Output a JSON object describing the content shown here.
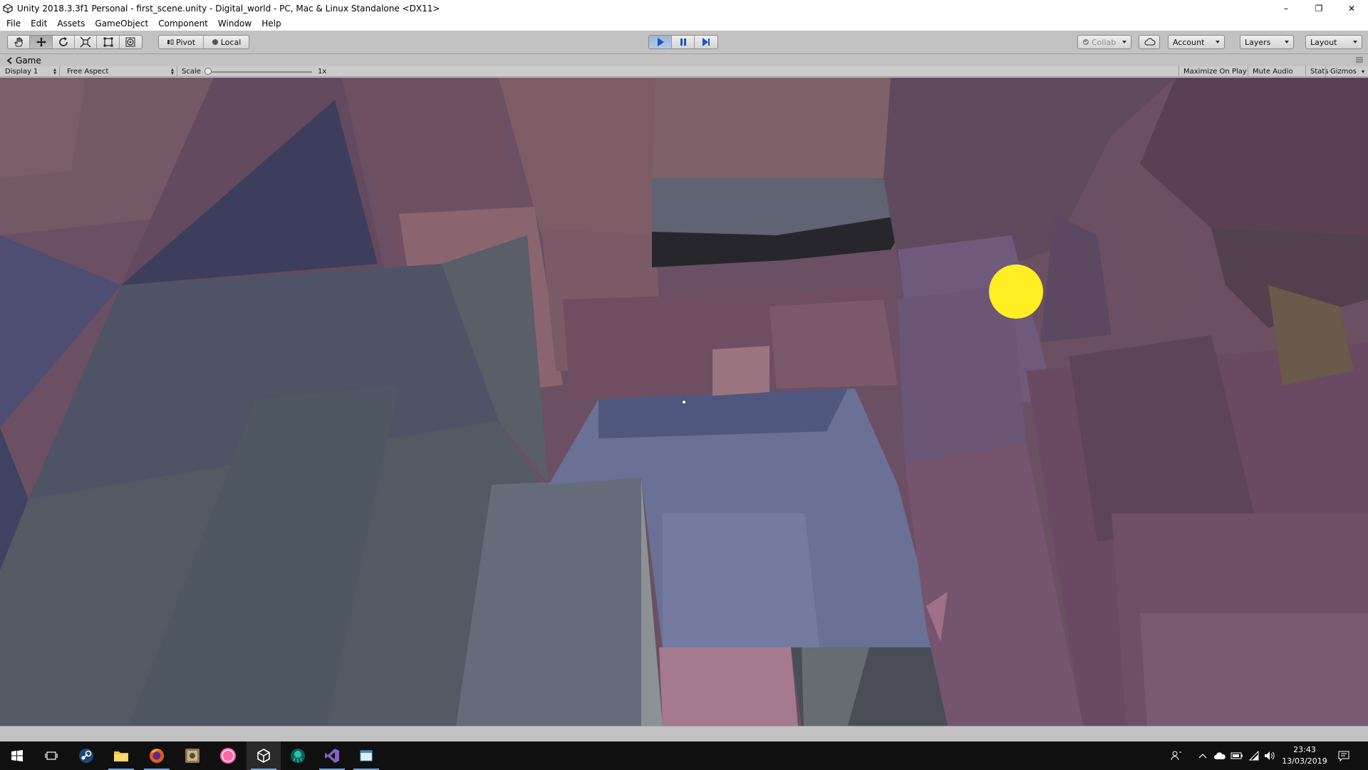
{
  "window": {
    "title": "Unity 2018.3.3f1 Personal - first_scene.unity - Digital_world - PC, Mac & Linux Standalone <DX11>",
    "controls": {
      "minimize": "–",
      "restore": "❐",
      "close": "✕"
    }
  },
  "menu": [
    "File",
    "Edit",
    "Assets",
    "GameObject",
    "Component",
    "Window",
    "Help"
  ],
  "toolbar": {
    "tools": [
      "hand-tool",
      "move-tool",
      "rotate-tool",
      "scale-tool",
      "rect-tool",
      "transform-tool"
    ],
    "active_tool": "move-tool",
    "pivot_label": "Pivot",
    "local_label": "Local",
    "play": {
      "playing": true,
      "paused": false
    },
    "collab_label": "Collab",
    "account_label": "Account",
    "layers_label": "Layers",
    "layout_label": "Layout"
  },
  "game_panel": {
    "tab_label": "Game",
    "display_label": "Display 1",
    "aspect_label": "Free Aspect",
    "scale_label": "Scale",
    "scale_value": "1x",
    "maximize_label": "Maximize On Play",
    "mute_label": "Mute Audio",
    "stats_label": "Stats",
    "gizmos_label": "Gizmos"
  },
  "taskbar": {
    "apps": [
      "start-button",
      "task-view",
      "steam",
      "file-explorer",
      "firefox",
      "image-app",
      "osu",
      "unity",
      "gitkraken",
      "visual-studio",
      "notepad-app"
    ],
    "active_app": "unity",
    "clock_time": "23:43",
    "clock_date": "13/03/2019"
  },
  "colors": {
    "editor_bg": "#c2c2c2",
    "play_active": "#9fb4d6",
    "sun_yellow": "#ffee22",
    "taskbar_bg": "#101010"
  }
}
